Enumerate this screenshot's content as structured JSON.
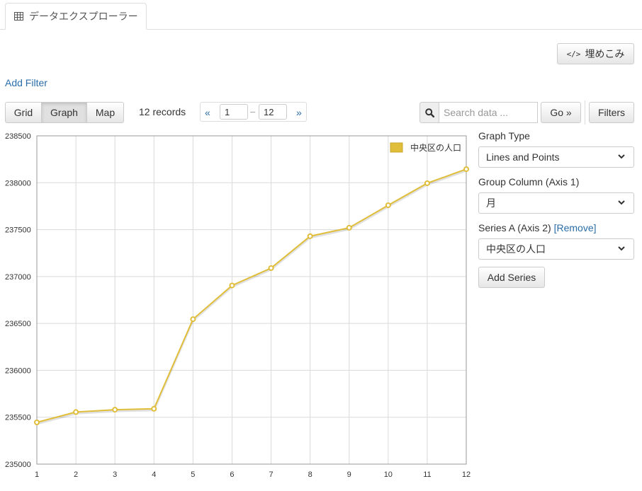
{
  "tab": {
    "title": "データエクスプローラー"
  },
  "toolbar": {
    "embed_label": "埋めこみ",
    "add_filter": "Add Filter",
    "views": [
      "Grid",
      "Graph",
      "Map"
    ],
    "active_view": "Graph",
    "records": "12 records",
    "pager": {
      "prev": "«",
      "next": "»",
      "from": "1",
      "to": "12",
      "dash": "–"
    },
    "search": {
      "placeholder": "Search data ...",
      "value": ""
    },
    "go_label": "Go »",
    "filters_label": "Filters"
  },
  "panel": {
    "graph_type_label": "Graph Type",
    "graph_type_value": "Lines and Points",
    "group_column_label": "Group Column (Axis 1)",
    "group_column_value": "月",
    "series_label": "Series A (Axis 2)",
    "remove_label": "[Remove]",
    "series_value": "中央区の人口",
    "add_series_label": "Add Series"
  },
  "chart_data": {
    "type": "line",
    "x": [
      1,
      2,
      3,
      4,
      5,
      6,
      7,
      8,
      9,
      10,
      11,
      12
    ],
    "series": [
      {
        "name": "中央区の人口",
        "values": [
          235445,
          235555,
          235580,
          235590,
          236545,
          236905,
          237090,
          237430,
          237520,
          237760,
          237995,
          238145
        ]
      }
    ],
    "ylim": [
      235000,
      238500
    ],
    "yticks": [
      235000,
      235500,
      236000,
      236500,
      237000,
      237500,
      238000,
      238500
    ],
    "xlim": [
      1,
      12
    ],
    "grid": true,
    "legend": "top-right",
    "color": "#e0be3a"
  }
}
